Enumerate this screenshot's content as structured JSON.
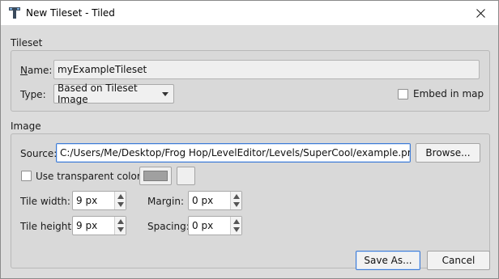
{
  "window": {
    "title": "New Tileset - Tiled",
    "app_icon": "tiled-app-icon",
    "close_icon": "close-icon",
    "accent_color": "#3d7bd6"
  },
  "tileset_group": {
    "title": "Tileset",
    "name_label": "Name:",
    "name_value": "myExampleTileset",
    "type_label": "Type:",
    "type_value": "Based on Tileset Image",
    "embed_label": "Embed in map",
    "embed_checked": false
  },
  "image_group": {
    "title": "Image",
    "source_label": "Source:",
    "source_value": "C:/Users/Me/Desktop/Frog Hop/LevelEditor/Levels/SuperCool/example.png",
    "browse_label": "Browse...",
    "transparent_label": "Use transparent color:",
    "transparent_checked": false,
    "transparent_color": "#a0a0a0",
    "tile_width_label": "Tile width:",
    "tile_width_value": "9 px",
    "tile_height_label": "Tile height:",
    "tile_height_value": "9 px",
    "margin_label": "Margin:",
    "margin_value": "0 px",
    "spacing_label": "Spacing:",
    "spacing_value": "0 px"
  },
  "buttons": {
    "save_as": "Save As...",
    "cancel": "Cancel"
  }
}
